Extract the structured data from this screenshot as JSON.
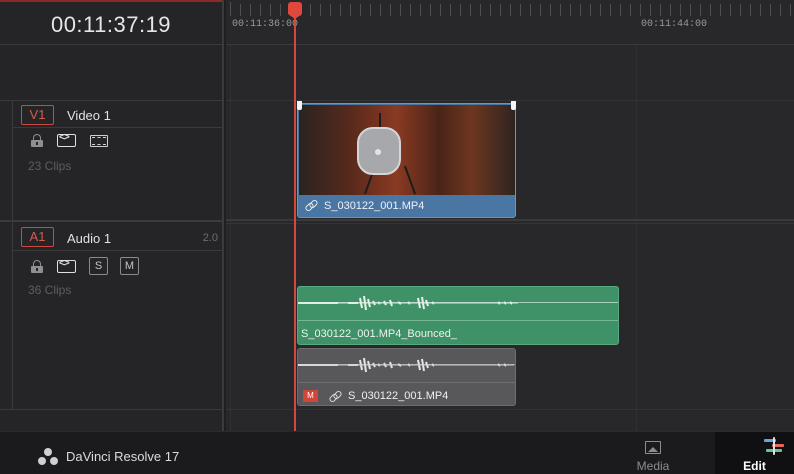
{
  "header": {
    "timecode": "00:11:37:19"
  },
  "ruler": {
    "labels": [
      "00:11:36:00",
      "00:11:44:00"
    ]
  },
  "tracks": {
    "video": {
      "id": "V1",
      "name": "Video 1",
      "clip_count": "23 Clips"
    },
    "audio": {
      "id": "A1",
      "name": "Audio 1",
      "channel": "2.0",
      "clip_count": "36 Clips",
      "solo_label": "S",
      "mute_label": "M"
    }
  },
  "clips": {
    "video": {
      "name": "S_030122_001.MP4"
    },
    "audio_bounced": {
      "name": "S_030122_001.MP4_Bounced_"
    },
    "audio_original": {
      "name": "S_030122_001.MP4",
      "badge": "M"
    }
  },
  "colors": {
    "accent_red": "#d3493f",
    "video_clip": "#4a76a4",
    "audio_clip_bounced": "#3f9167",
    "audio_clip_muted": "#58585b"
  },
  "footer": {
    "app_name": "DaVinci Resolve 17"
  },
  "pages": {
    "media": "Media",
    "edit": "Edit",
    "active": "Edit"
  }
}
